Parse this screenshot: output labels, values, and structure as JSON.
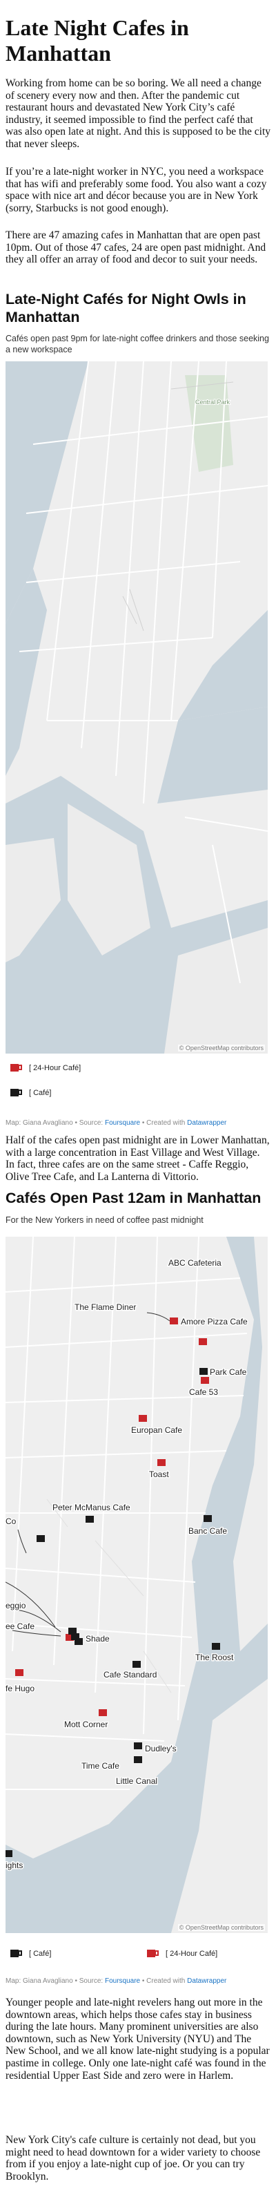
{
  "article": {
    "title": "Late Night Cafes in Manhattan",
    "p1": "Working from home can be so boring. We all need a change of scenery every now and then. After the pandemic cut restaurant hours and devastated New York City’s café industry, it seemed impossible to find the perfect café that was also open late at night. And this is supposed to be the city that never sleeps.",
    "p2": "If you’re a late-night worker in NYC, you need a workspace that has wifi and preferably some food. You also want a cozy space with nice art and décor because you are in New York (sorry, Starbucks is not good enough).",
    "p3": "There are 47 amazing cafes in Manhattan that are open past 10pm. Out of those 47 cafes, 24 are open past midnight. And they all offer an array of food and decor to suit your needs.",
    "p4": "Half of the cafes open past midnight are in Lower Manhattan, with a large concentration in East Village and West Village. In fact, three cafes are on the same street - Caffe Reggio, Olive Tree Cafe, and La Lanterna di Vittorio.",
    "p5": "Younger people and late-night revelers hang out more in the downtown areas, which helps those cafes stay in business during the late hours. Many prominent universities are also downtown, such as New York University (NYU) and The New School, and we all know late-night studying is a popular pastime in college. Only one late-night café was found in the residential Upper East Side and zero were in Harlem.",
    "p6": "New York City's cafe culture is certainly not dead, but you might need to head downtown for a wider variety to choose from if you enjoy a late-night cup of joe. Or you can try Brooklyn."
  },
  "map1": {
    "title": "Late-Night Cafés for Night Owls in Manhattan",
    "subtitle": "Cafés open past 9pm for late-night coffee drinkers and those seeking a new workspace",
    "park_label": "Central Park",
    "attribution": "© OpenStreetMap contributors",
    "legend": [
      "[ 24-Hour Café]",
      "[ Café]"
    ],
    "credit_prefix": "Map: Giana Avagliano • Source: ",
    "credit_source": "Foursquare",
    "credit_mid": " • Created with ",
    "credit_tool": "Datawrapper"
  },
  "map2": {
    "title": "Cafés Open Past 12am in Manhattan",
    "subtitle": "For the New Yorkers in need of coffee past midnight",
    "attribution": "© OpenStreetMap contributors",
    "legend": [
      "[ Café]",
      "[ 24-Hour Café]"
    ],
    "credit_prefix": "Map: Giana Avagliano • Source: ",
    "credit_source": "Foursquare",
    "credit_mid": " • Created with ",
    "credit_tool": "Datawrapper",
    "labels": {
      "abc": "ABC Cafeteria",
      "flame": "The Flame Diner",
      "amore": "Amore Pizza Cafe",
      "park": "Park Cafe",
      "cafe53": "Cafe 53",
      "europan": "Europan Cafe",
      "toast": "Toast",
      "mcmanus": "Peter McManus Cafe",
      "banc": "Banc Cafe",
      "co": "Co",
      "eggio": "eggio",
      "eecafe": "ee Cafe",
      "shade": "Shade",
      "roost": "The Roost",
      "standard": "Cafe Standard",
      "hugo": "fe Hugo",
      "mott": "Mott Corner",
      "dudley": "Dudley's",
      "timecafe": "Time Cafe",
      "canal": "Little Canal",
      "lights": "ights"
    }
  },
  "colors": {
    "cafe24": "#c9262a",
    "cafe": "#1a1a1a",
    "water": "#c8d4dc",
    "land": "#efefef",
    "park": "#d8e4d5",
    "link": "#1a73c4"
  }
}
